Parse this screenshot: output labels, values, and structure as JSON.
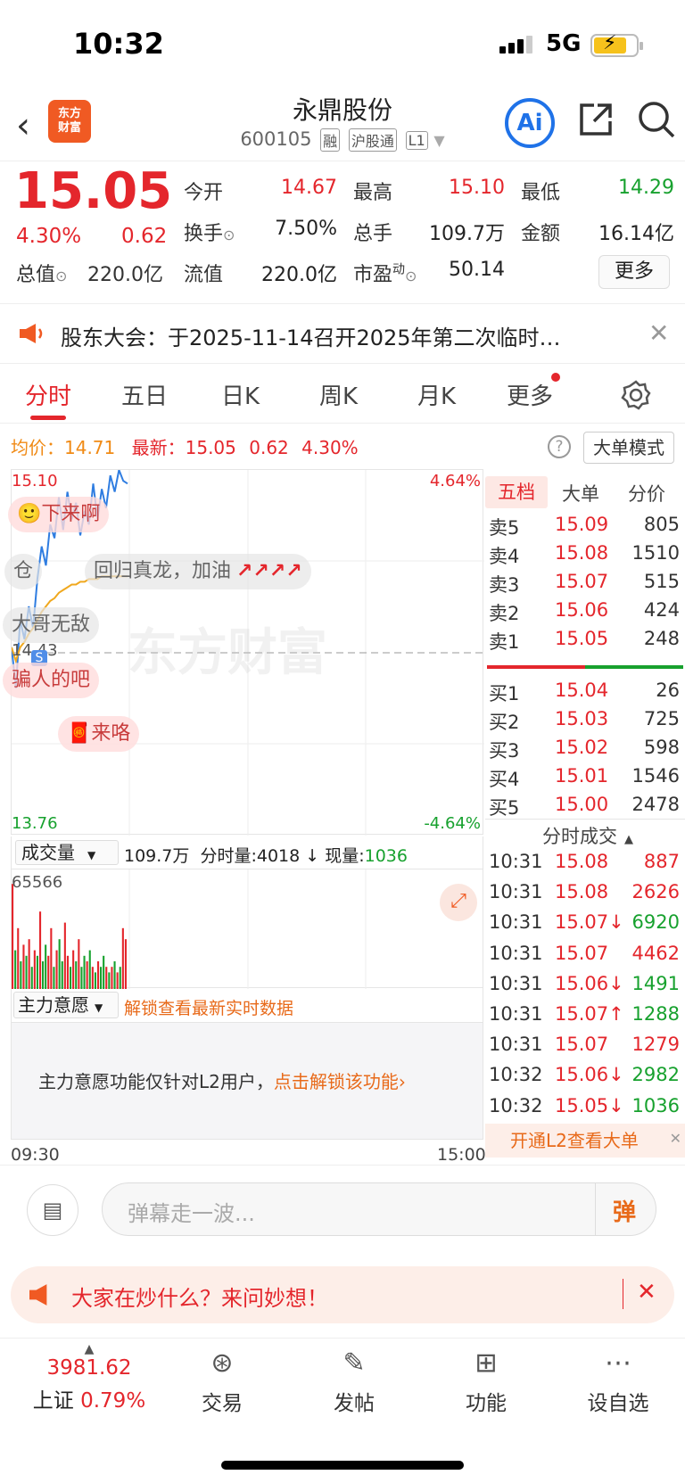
{
  "status": {
    "time": "10:32",
    "network": "5G"
  },
  "header": {
    "logo_text_1": "东方",
    "logo_text_2": "财富",
    "stock_name": "永鼎股份",
    "stock_code": "600105",
    "tags": [
      "融",
      "沪股通",
      "L1"
    ],
    "ai_label": "Ai"
  },
  "quote": {
    "price": "15.05",
    "change_pct": "4.30%",
    "change_amt": "0.62",
    "mktcap_label": "总值",
    "mktcap": "220.0亿",
    "open_label": "今开",
    "open": "14.67",
    "high_label": "最高",
    "high": "15.10",
    "low_label": "最低",
    "low": "14.29",
    "turnover_label": "换手",
    "turnover": "7.50%",
    "volume_label": "总手",
    "volume": "109.7万",
    "amount_label": "金额",
    "amount": "16.14亿",
    "float_label": "流值",
    "float": "220.0亿",
    "pe_label": "市盈",
    "pe_sup": "动",
    "pe": "50.14",
    "more": "更多"
  },
  "notice": {
    "text": "股东大会：于2025-11-14召开2025年第二次临时…"
  },
  "tabs": [
    "分时",
    "五日",
    "日K",
    "周K",
    "月K",
    "更多"
  ],
  "chart": {
    "avg_label": "均价：",
    "avg": "14.71",
    "latest_label": "最新：",
    "latest": "15.05",
    "latest_chg": "0.62",
    "latest_pct": "4.30%",
    "bigorder_mode": "大单模式",
    "price_top": "15.10",
    "price_bottom": "13.76",
    "pct_top": "4.64%",
    "pct_bottom": "-4.64%",
    "prev_close": "14.43",
    "watermark": "东方财富",
    "time_start": "09:30",
    "time_end": "15:00",
    "danmu": [
      "下来啊",
      "仓",
      "回归真龙，加油",
      "大哥无敌",
      "骗人的吧",
      "来咯"
    ],
    "ss_badge": "S"
  },
  "chart_data": {
    "type": "line",
    "series": [
      {
        "values": [
          14.45,
          14.3,
          14.55,
          14.48,
          14.6,
          14.52,
          14.7,
          14.82,
          14.75,
          14.9,
          14.85,
          15.0,
          14.88,
          15.02,
          14.92,
          14.98,
          14.86,
          14.95,
          14.9,
          15.05,
          14.92,
          15.03,
          14.96,
          15.08,
          15.02,
          15.1,
          15.06,
          15.05
        ]
      },
      {
        "values": [
          14.45,
          14.4,
          14.45,
          14.47,
          14.5,
          14.52,
          14.55,
          14.58,
          14.6,
          14.62,
          14.63,
          14.65,
          14.66,
          14.67,
          14.68,
          14.68,
          14.69,
          14.69,
          14.7,
          14.7,
          14.7,
          14.71,
          14.71,
          14.71,
          14.71,
          14.71,
          14.71,
          14.71
        ]
      }
    ],
    "ylim": [
      13.76,
      15.1
    ]
  },
  "volume": {
    "label": "成交量",
    "total": "109.7万",
    "tick_label": "分时量:",
    "tick": "4018",
    "now_label": "现量:",
    "now": "1036",
    "max": "65566",
    "bars": [
      0.95,
      0.35,
      0.55,
      0.25,
      0.4,
      0.3,
      0.45,
      0.2,
      0.35,
      0.3,
      0.7,
      0.25,
      0.4,
      0.3,
      0.55,
      0.2,
      0.35,
      0.45,
      0.25,
      0.6,
      0.3,
      0.2,
      0.35,
      0.25,
      0.45,
      0.2,
      0.3,
      0.25,
      0.35,
      0.2,
      0.15,
      0.25,
      0.2,
      0.3,
      0.2,
      0.15,
      0.2,
      0.25,
      0.15,
      0.2,
      0.55,
      0.45
    ],
    "bar_colors": [
      "r",
      "g",
      "r",
      "g",
      "r",
      "g",
      "r",
      "g",
      "r",
      "g",
      "r",
      "g",
      "g",
      "r",
      "r",
      "g",
      "r",
      "g",
      "g",
      "r",
      "r",
      "g",
      "r",
      "g",
      "r",
      "g",
      "g",
      "r",
      "g",
      "r",
      "g",
      "r",
      "g",
      "g",
      "r",
      "g",
      "r",
      "g",
      "r",
      "g",
      "r",
      "r"
    ]
  },
  "intent": {
    "label": "主力意愿",
    "unlock_link": "解锁查看最新实时数据",
    "msg": "主力意愿功能仅针对L2用户，",
    "msg_link": "点击解锁该功能"
  },
  "orderbook": {
    "tabs": [
      "五档",
      "大单",
      "分价"
    ],
    "asks": [
      {
        "label": "卖5",
        "price": "15.09",
        "vol": "805"
      },
      {
        "label": "卖4",
        "price": "15.08",
        "vol": "1510"
      },
      {
        "label": "卖3",
        "price": "15.07",
        "vol": "515"
      },
      {
        "label": "卖2",
        "price": "15.06",
        "vol": "424"
      },
      {
        "label": "卖1",
        "price": "15.05",
        "vol": "248"
      }
    ],
    "bids": [
      {
        "label": "买1",
        "price": "15.04",
        "vol": "26"
      },
      {
        "label": "买2",
        "price": "15.03",
        "vol": "725"
      },
      {
        "label": "买3",
        "price": "15.02",
        "vol": "598"
      },
      {
        "label": "买4",
        "price": "15.01",
        "vol": "1546"
      },
      {
        "label": "买5",
        "price": "15.00",
        "vol": "2478"
      }
    ],
    "trades_title": "分时成交",
    "trades": [
      {
        "t": "10:31",
        "p": "15.08",
        "v": "887",
        "c": "red",
        "arrow": ""
      },
      {
        "t": "10:31",
        "p": "15.08",
        "v": "2626",
        "c": "red",
        "arrow": ""
      },
      {
        "t": "10:31",
        "p": "15.07↓",
        "v": "6920",
        "c": "green",
        "arrow": ""
      },
      {
        "t": "10:31",
        "p": "15.07",
        "v": "4462",
        "c": "red",
        "arrow": ""
      },
      {
        "t": "10:31",
        "p": "15.06↓",
        "v": "1491",
        "c": "green",
        "arrow": ""
      },
      {
        "t": "10:31",
        "p": "15.07↑",
        "v": "1288",
        "c": "green",
        "arrow": ""
      },
      {
        "t": "10:31",
        "p": "15.07",
        "v": "1279",
        "c": "red",
        "arrow": ""
      },
      {
        "t": "10:32",
        "p": "15.06↓",
        "v": "2982",
        "c": "green",
        "arrow": ""
      },
      {
        "t": "10:32",
        "p": "15.05↓",
        "v": "1036",
        "c": "green",
        "arrow": ""
      }
    ],
    "l2_banner": "开通L2查看大单"
  },
  "comment": {
    "placeholder": "弹幕走一波...",
    "danmu_btn": "弹"
  },
  "ask_banner": {
    "text": "大家在炒什么？来问妙想！"
  },
  "nav": {
    "index_value": "3981.62",
    "index_name": "上证",
    "index_pct": "0.79%",
    "items": [
      "交易",
      "发帖",
      "功能",
      "设自选"
    ]
  },
  "colors": {
    "up": "#e4262c",
    "down": "#17a12e",
    "accent": "#f08a15"
  }
}
